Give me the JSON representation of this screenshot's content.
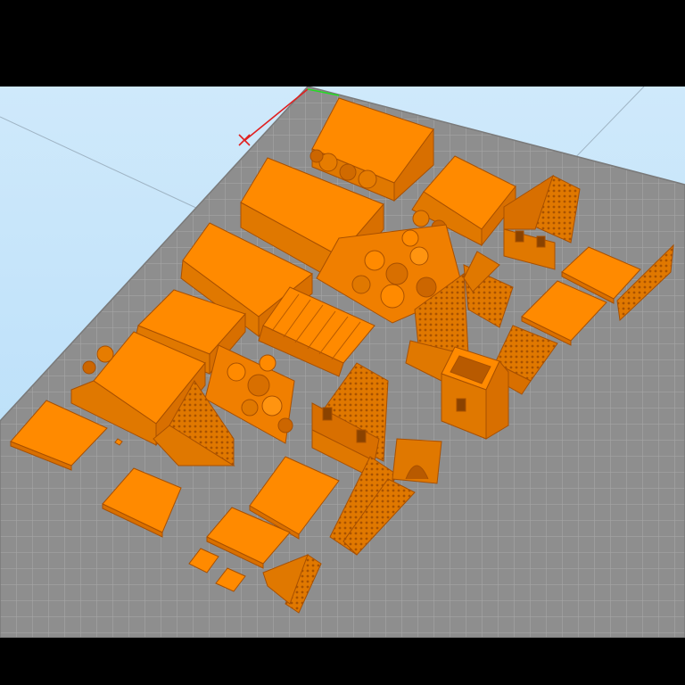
{
  "viewport": {
    "background_top": "#cfe9fb",
    "background_bottom": "#b3dcf8",
    "bed_color": "#8e8e8e",
    "grid_color": "#a9a9a9",
    "model_color": "#ff8a00",
    "model_shade": "#d86f00",
    "model_dark": "#b85a00",
    "axis_x_color": "#e02020",
    "axis_y_color": "#22dd22"
  },
  "scene": {
    "icons": {
      "axis_gizmo": "axis-gizmo-icon"
    }
  }
}
